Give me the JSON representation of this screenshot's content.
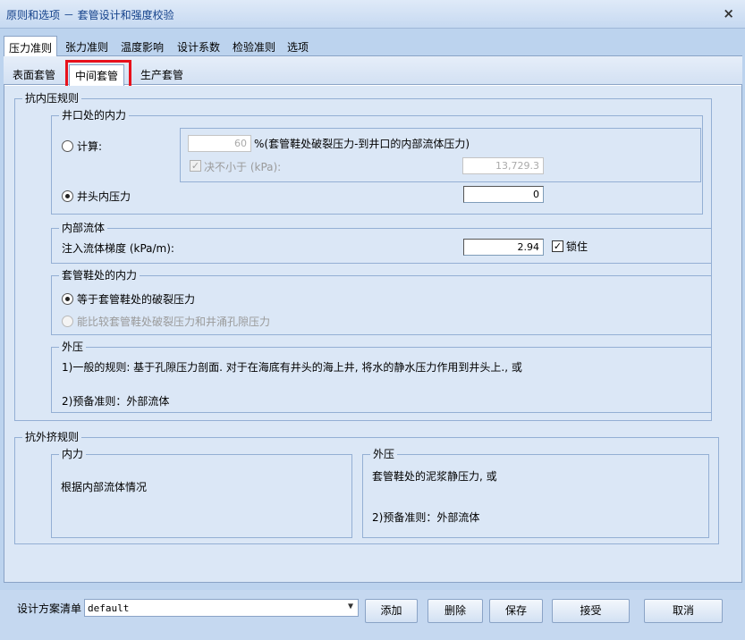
{
  "window": {
    "title": "原则和选项 － 套管设计和强度校验",
    "close_symbol": "×"
  },
  "outer_tabs": [
    "压力准则",
    "张力准则",
    "温度影响",
    "设计系数",
    "检验准则",
    "选项"
  ],
  "inner_tabs": [
    "表面套管",
    "中间套管",
    "生产套管"
  ],
  "burst": {
    "title": "抗内压规则",
    "wellhead": {
      "title": "井口处的内力",
      "calc_label": "计算:",
      "percent_value": "60",
      "percent_desc": "%(套管鞋处破裂压力-到井口的内部流体压力)",
      "min_label": "决不小于 (kPa):",
      "min_value": "13,729.3",
      "wellhead_label": "井头内压力",
      "wellhead_value": "0"
    },
    "fluid": {
      "title": "内部流体",
      "gradient_label": "注入流体梯度 (kPa/m):",
      "gradient_value": "2.94",
      "lock_label": "锁住"
    },
    "shoe": {
      "title": "套管鞋处的内力",
      "option1": "等于套管鞋处的破裂压力",
      "option2": "能比较套管鞋处破裂压力和井涌孔隙压力"
    },
    "external": {
      "title": "外压",
      "line1": "1)一般的规则: 基于孔隙压力剖面. 对于在海底有井头的海上井, 将水的静水压力作用到井头上., 或",
      "line2": "2)预备准则：外部流体"
    }
  },
  "collapse": {
    "title": "抗外挤规则",
    "internal": {
      "title": "内力",
      "text": "根据内部流体情况"
    },
    "external": {
      "title": "外压",
      "line1": "套管鞋处的泥浆静压力, 或",
      "line2": "2)预备准则：外部流体"
    }
  },
  "footer": {
    "scheme_label": "设计方案清单",
    "scheme_value": "default",
    "buttons": {
      "add": "添加",
      "delete": "删除",
      "save": "保存",
      "accept": "接受",
      "cancel": "取消"
    }
  },
  "colors": {
    "highlight": "#e8111b",
    "panel_bg": "#dbe7f6",
    "border": "#94afd4"
  }
}
